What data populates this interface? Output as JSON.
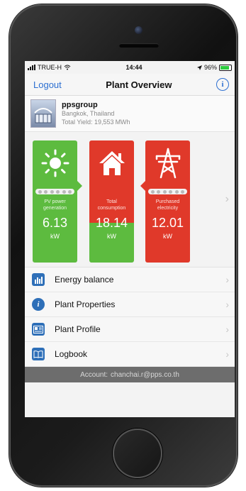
{
  "status_bar": {
    "carrier": "TRUE-H",
    "time": "14:44",
    "battery": "96%"
  },
  "nav": {
    "back_label": "Logout",
    "title": "Plant Overview",
    "info_icon": "i"
  },
  "plant": {
    "name": "ppsgroup",
    "location": "Bangkok, Thailand",
    "total_yield_label": "Total Yield: 19,553",
    "total_yield_unit": "MWh"
  },
  "energy": {
    "pv": {
      "label_line1": "PV power",
      "label_line2": "generation",
      "value": "6.13",
      "unit": "kW",
      "icon": "sun-icon"
    },
    "consumption": {
      "label_line1": "Total",
      "label_line2": "consumption",
      "value": "18.14",
      "unit": "kW",
      "icon": "house-icon"
    },
    "purchased": {
      "label_line1": "Purchased",
      "label_line2": "electricity",
      "value": "12.01",
      "unit": "kW",
      "icon": "power-tower-icon"
    }
  },
  "menu": [
    {
      "label": "Energy balance",
      "icon": "bar-chart-icon"
    },
    {
      "label": "Plant Properties",
      "icon": "info-icon"
    },
    {
      "label": "Plant Profile",
      "icon": "profile-card-icon"
    },
    {
      "label": "Logbook",
      "icon": "book-icon"
    }
  ],
  "account": {
    "label": "Account:",
    "email": "chanchai.r@pps.co.th"
  },
  "colors": {
    "accent": "#2c6fd1",
    "green_tile": "#5dbb3f",
    "red_tile": "#e0392a",
    "account_bar": "#6d6d6d"
  }
}
